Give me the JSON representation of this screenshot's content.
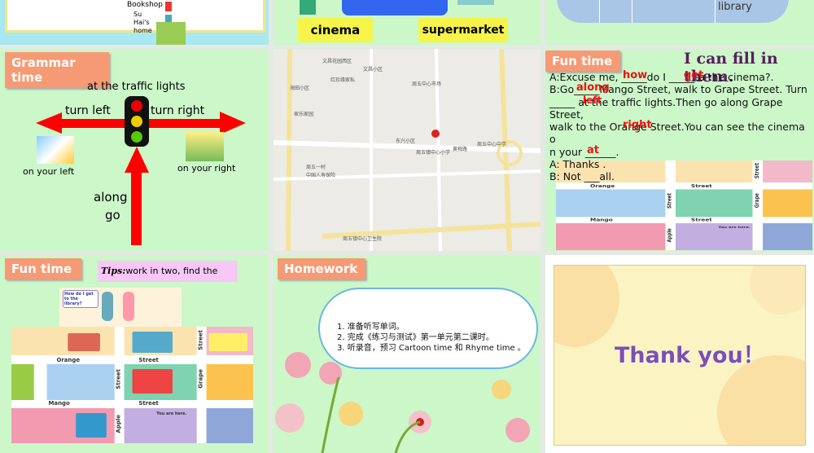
{
  "top_row": {
    "bookshop": "Bookshop",
    "home": "Su Hai's home",
    "cinema": "cinema",
    "supermarket": "supermarket",
    "library": "library"
  },
  "grammar": {
    "tag": "Grammar time",
    "traffic": "at the traffic lights",
    "turn_left": "turn left",
    "turn_right": "turn right",
    "on_left": "on your left",
    "on_right": "on your right",
    "along": "along",
    "go": "go"
  },
  "map_slide": {
    "labels": [
      "文昌花园西区",
      "文昌小区",
      "红珍缘家私",
      "周五中心市场",
      "海田小区",
      "家乐家园",
      "东兴小区",
      "黄梅路",
      "周五镇中心小学",
      "周五中心中学",
      "周五一村",
      "中国人寿保险",
      "周五镇中心卫生院"
    ]
  },
  "fun1": {
    "tag": "Fun time",
    "title": "I can fill in them.",
    "lines": [
      "A:Excuse me, _____do I _____to the cinema?.",
      "B:Go_____Mango Street, walk to Grape Street. Turn",
      "_____ at the traffic lights.Then go along Grape Street,",
      "walk to the Orange Street.You can see the cinema o",
      "n your ______.",
      "A: Thanks .",
      "B: Not ___all."
    ],
    "answers": {
      "how": "how",
      "get": "get",
      "along": "along",
      "left": "left",
      "right": "right",
      "at": "at"
    }
  },
  "street_map": {
    "orange": "Orange",
    "street": "Street",
    "mango": "Mango",
    "grape": "Grape",
    "apple": "Apple",
    "here": "You are here.",
    "question": "How do I get to the library?"
  },
  "fun2": {
    "tag": "Fun time",
    "tips_label": "Tips:",
    "tips": "work in two, find the way."
  },
  "homework": {
    "tag": "Homework",
    "items": [
      "1. 准备听写单词。",
      "2. 完成《练习与测试》第一单元第二课时。",
      "3. 听录音，预习 Cartoon time 和 Rhyme time 。"
    ]
  },
  "thanks": {
    "text": "Thank you！"
  }
}
